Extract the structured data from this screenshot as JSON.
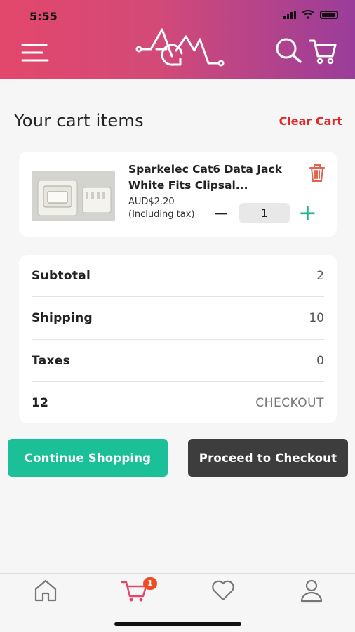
{
  "status_bar": {
    "time": "5:55"
  },
  "header": {
    "menu_icon": "hamburger-menu-icon",
    "logo_icon": "agm-logo",
    "search_icon": "search-icon",
    "cart_icon": "cart-icon",
    "gradient": [
      "#e3476b",
      "#9a3d9a"
    ]
  },
  "cart": {
    "title": "Your cart items",
    "clear_label": "Clear Cart",
    "items": [
      {
        "name": "Sparkelec Cat6 Data Jack White Fits Clipsal...",
        "price": "AUD$2.20",
        "tax_note": "(Including tax)",
        "quantity": "1"
      }
    ]
  },
  "summary": {
    "subtotal_label": "Subtotal",
    "subtotal_value": "2",
    "shipping_label": "Shipping",
    "shipping_value": "10",
    "taxes_label": "Taxes",
    "taxes_value": "0",
    "total_value": "12",
    "checkout_label": "CHECKOUT"
  },
  "actions": {
    "continue_label": "Continue Shopping",
    "proceed_label": "Proceed to Checkout"
  },
  "bottom_nav": {
    "items": [
      "home-icon",
      "cart-icon",
      "heart-icon",
      "profile-icon"
    ],
    "cart_badge": "1",
    "active": "cart"
  },
  "colors": {
    "accent_red": "#e4262b",
    "accent_green": "#1bbf98",
    "dark_button": "#3d3d3d",
    "nav_active": "#e3476b"
  }
}
